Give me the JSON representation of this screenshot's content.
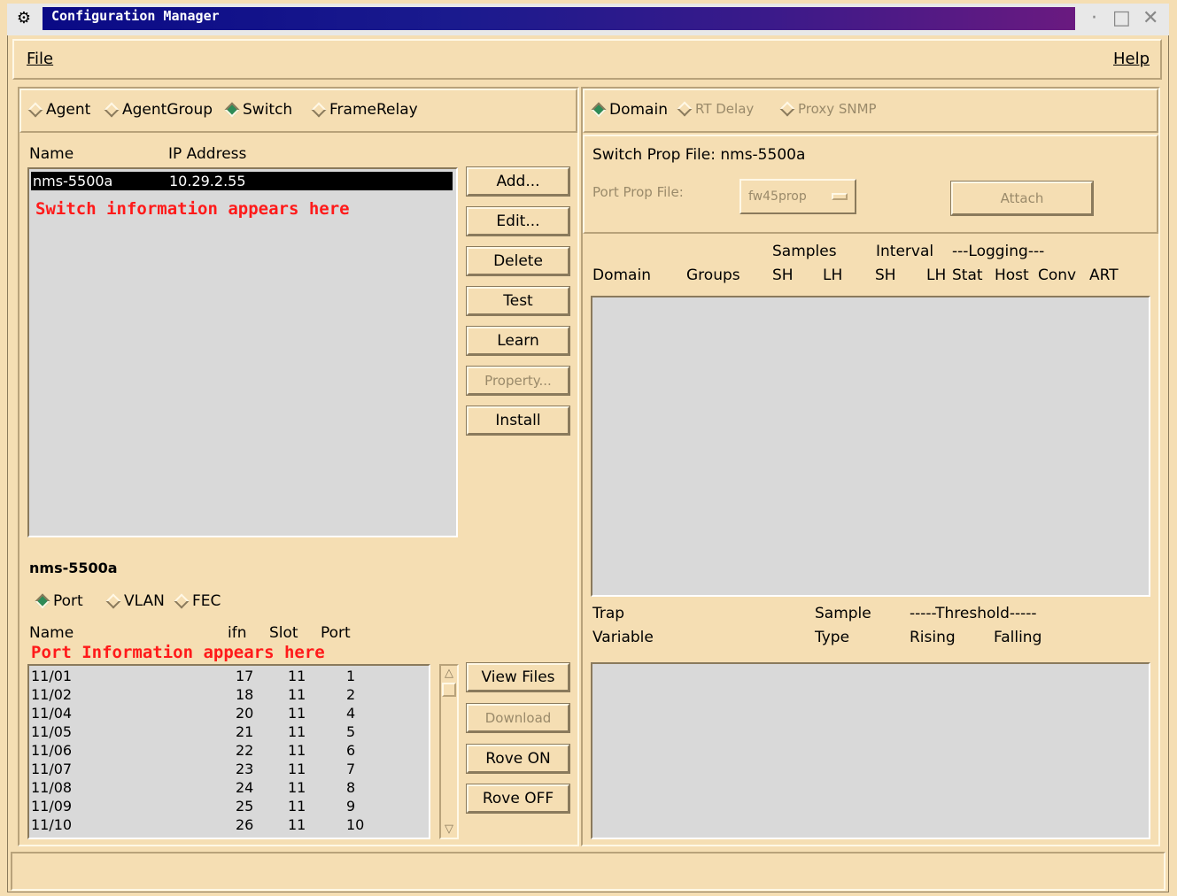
{
  "window": {
    "title": "Configuration Manager"
  },
  "menu": {
    "file": "File",
    "help": "Help"
  },
  "left": {
    "tabs": [
      {
        "label": "Agent",
        "selected": false
      },
      {
        "label": "AgentGroup",
        "selected": false
      },
      {
        "label": "Switch",
        "selected": true
      },
      {
        "label": "FrameRelay",
        "selected": false
      }
    ],
    "switch_list": {
      "col_name": "Name",
      "col_ip": "IP Address",
      "rows": [
        {
          "name": "nms-5500a",
          "ip": "10.29.2.55"
        }
      ],
      "annotation": "Switch information appears here"
    },
    "buttons": {
      "add": "Add...",
      "edit": "Edit...",
      "delete": "Delete",
      "test": "Test",
      "learn": "Learn",
      "property": "Property...",
      "install": "Install"
    },
    "selected_switch": "nms-5500a",
    "port_tabs": [
      {
        "label": "Port",
        "selected": true
      },
      {
        "label": "VLAN",
        "selected": false
      },
      {
        "label": "FEC",
        "selected": false
      }
    ],
    "port_list": {
      "col_name": "Name",
      "col_ifn": "ifn",
      "col_slot": "Slot",
      "col_port": "Port",
      "annotation": "Port Information appears here",
      "rows": [
        {
          "name": "11/01",
          "ifn": "17",
          "slot": "11",
          "port": "1"
        },
        {
          "name": "11/02",
          "ifn": "18",
          "slot": "11",
          "port": "2"
        },
        {
          "name": "11/04",
          "ifn": "20",
          "slot": "11",
          "port": "4"
        },
        {
          "name": "11/05",
          "ifn": "21",
          "slot": "11",
          "port": "5"
        },
        {
          "name": "11/06",
          "ifn": "22",
          "slot": "11",
          "port": "6"
        },
        {
          "name": "11/07",
          "ifn": "23",
          "slot": "11",
          "port": "7"
        },
        {
          "name": "11/08",
          "ifn": "24",
          "slot": "11",
          "port": "8"
        },
        {
          "name": "11/09",
          "ifn": "25",
          "slot": "11",
          "port": "9"
        },
        {
          "name": "11/10",
          "ifn": "26",
          "slot": "11",
          "port": "10"
        }
      ]
    },
    "port_buttons": {
      "view_files": "View Files",
      "download": "Download",
      "rove_on": "Rove ON",
      "rove_off": "Rove OFF"
    }
  },
  "right": {
    "tabs": [
      {
        "label": "Domain",
        "selected": true
      },
      {
        "label": "RT Delay",
        "selected": false
      },
      {
        "label": "Proxy SNMP",
        "selected": false
      }
    ],
    "switch_prop_label": "Switch Prop File:",
    "switch_prop_value": "nms-5500a",
    "port_prop_label": "Port Prop File:",
    "port_prop_value": "fw45prop",
    "attach": "Attach",
    "domain_table": {
      "group_samples": "Samples",
      "group_interval": "Interval",
      "group_logging": "---Logging---",
      "cols": [
        "Domain",
        "Groups",
        "SH",
        "LH",
        "SH",
        "LH",
        "Stat",
        "Host",
        "Conv",
        "ART"
      ]
    },
    "trap_table": {
      "trap": "Trap",
      "variable": "Variable",
      "sample": "Sample",
      "type": "Type",
      "threshold": "-----Threshold-----",
      "rising": "Rising",
      "falling": "Falling"
    }
  }
}
